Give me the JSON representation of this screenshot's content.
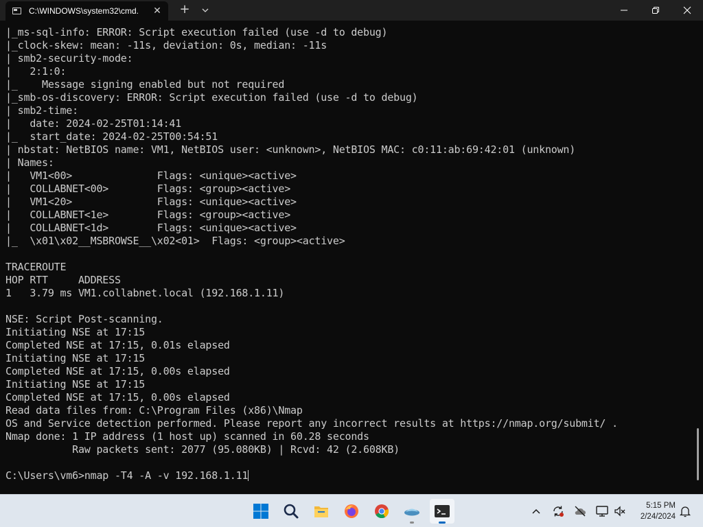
{
  "window": {
    "tab_title": "C:\\WINDOWS\\system32\\cmd.",
    "tab_icon": "cmd-icon",
    "new_tab_label": "+",
    "close_tab_label": "✕"
  },
  "terminal": {
    "lines": [
      "|_ms-sql-info: ERROR: Script execution failed (use -d to debug)",
      "|_clock-skew: mean: -11s, deviation: 0s, median: -11s",
      "| smb2-security-mode:",
      "|   2:1:0:",
      "|_    Message signing enabled but not required",
      "|_smb-os-discovery: ERROR: Script execution failed (use -d to debug)",
      "| smb2-time:",
      "|   date: 2024-02-25T01:14:41",
      "|_  start_date: 2024-02-25T00:54:51",
      "| nbstat: NetBIOS name: VM1, NetBIOS user: <unknown>, NetBIOS MAC: c0:11:ab:69:42:01 (unknown)",
      "| Names:",
      "|   VM1<00>              Flags: <unique><active>",
      "|   COLLABNET<00>        Flags: <group><active>",
      "|   VM1<20>              Flags: <unique><active>",
      "|   COLLABNET<1e>        Flags: <group><active>",
      "|   COLLABNET<1d>        Flags: <unique><active>",
      "|_  \\x01\\x02__MSBROWSE__\\x02<01>  Flags: <group><active>",
      "",
      "TRACEROUTE",
      "HOP RTT     ADDRESS",
      "1   3.79 ms VM1.collabnet.local (192.168.1.11)",
      "",
      "NSE: Script Post-scanning.",
      "Initiating NSE at 17:15",
      "Completed NSE at 17:15, 0.01s elapsed",
      "Initiating NSE at 17:15",
      "Completed NSE at 17:15, 0.00s elapsed",
      "Initiating NSE at 17:15",
      "Completed NSE at 17:15, 0.00s elapsed",
      "Read data files from: C:\\Program Files (x86)\\Nmap",
      "OS and Service detection performed. Please report any incorrect results at https://nmap.org/submit/ .",
      "Nmap done: 1 IP address (1 host up) scanned in 60.28 seconds",
      "           Raw packets sent: 2077 (95.080KB) | Rcvd: 42 (2.608KB)",
      ""
    ],
    "prompt": "C:\\Users\\vm6>",
    "command": "nmap -T4 -A -v 192.168.1.11"
  },
  "taskbar": {
    "apps": [
      {
        "name": "start-button",
        "icon": "windows-icon"
      },
      {
        "name": "search-button",
        "icon": "search-icon"
      },
      {
        "name": "file-explorer",
        "icon": "folder-icon"
      },
      {
        "name": "firefox",
        "icon": "firefox-icon"
      },
      {
        "name": "chrome",
        "icon": "chrome-icon"
      },
      {
        "name": "wireshark-app",
        "icon": "fin-icon"
      },
      {
        "name": "terminal",
        "icon": "terminal-icon"
      }
    ],
    "clock_time": "5:15 PM",
    "clock_date": "2/24/2024"
  },
  "colors": {
    "terminal_bg": "#0c0c0c",
    "terminal_fg": "#cccccc",
    "titlebar_bg": "#202020",
    "taskbar_bg": "#dfe6ee",
    "accent": "#0067c0"
  }
}
